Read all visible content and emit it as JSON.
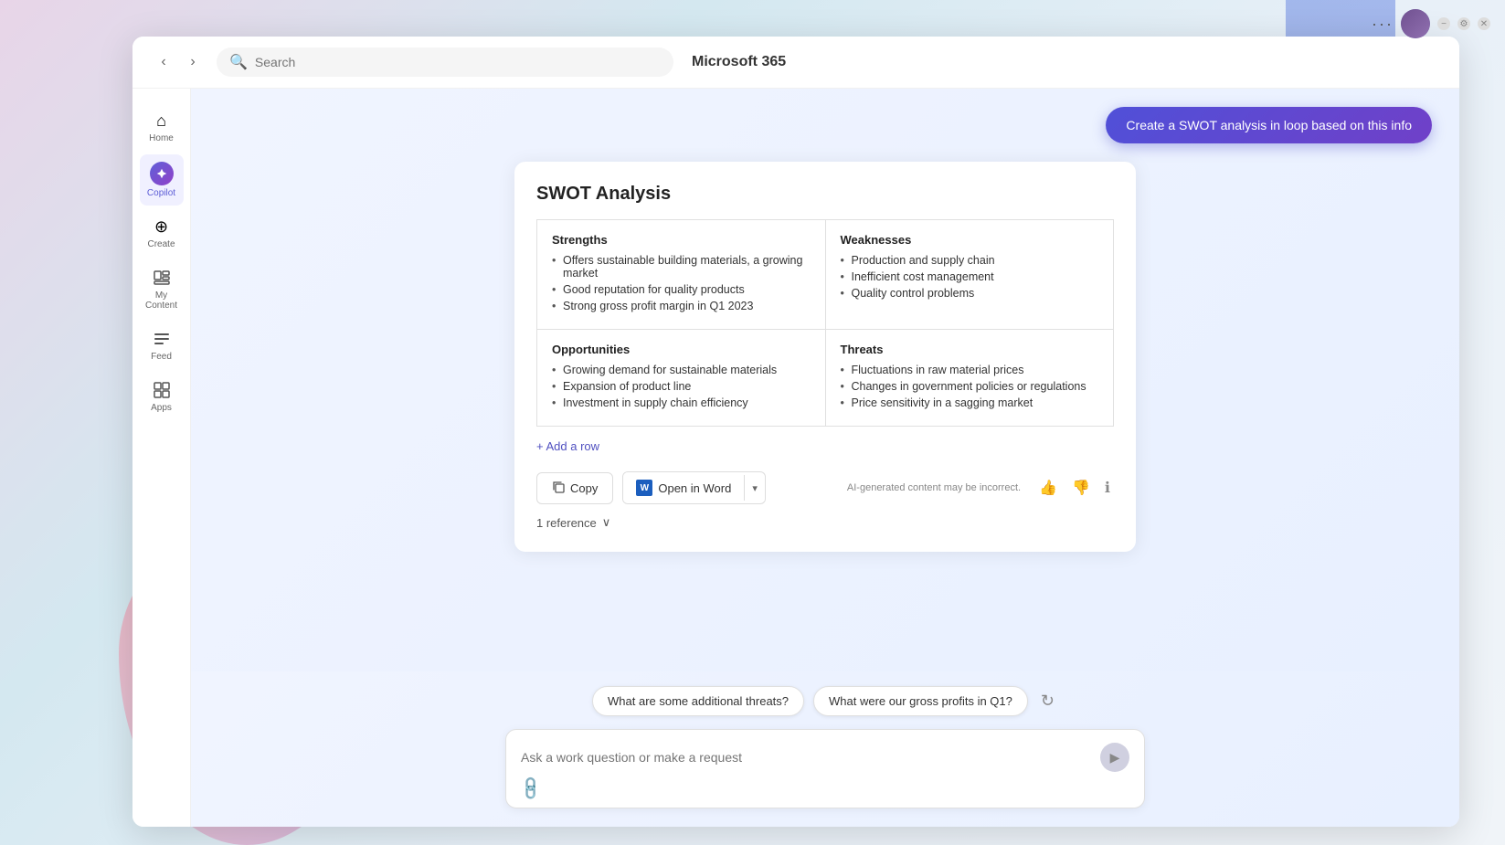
{
  "window": {
    "title": "Microsoft 365",
    "controls": {
      "dots": "···",
      "minimize": "−",
      "settings": "⚙",
      "close": "✕"
    }
  },
  "topbar": {
    "search_placeholder": "Search",
    "app_title": "Microsoft 365"
  },
  "sidebar": {
    "items": [
      {
        "id": "home",
        "label": "Home",
        "icon": "⌂"
      },
      {
        "id": "copilot",
        "label": "Copilot",
        "icon": "✦",
        "active": true
      },
      {
        "id": "create",
        "label": "Create",
        "icon": "⊕"
      },
      {
        "id": "my-content",
        "label": "My Content",
        "icon": "▤"
      },
      {
        "id": "feed",
        "label": "Feed",
        "icon": "≡"
      },
      {
        "id": "apps",
        "label": "Apps",
        "icon": "⊞"
      }
    ]
  },
  "create_swot_button": "Create a SWOT analysis in loop based on this info",
  "swot": {
    "title": "SWOT Analysis",
    "strengths": {
      "heading": "Strengths",
      "items": [
        "Offers sustainable building materials, a growing market",
        "Good reputation for quality products",
        "Strong gross profit margin in Q1 2023"
      ]
    },
    "weaknesses": {
      "heading": "Weaknesses",
      "items": [
        "Production and supply chain",
        "Inefficient cost management",
        "Quality control problems"
      ]
    },
    "opportunities": {
      "heading": "Opportunities",
      "items": [
        "Growing demand for sustainable materials",
        "Expansion of product line",
        "Investment in supply chain efficiency"
      ]
    },
    "threats": {
      "heading": "Threats",
      "items": [
        "Fluctuations in raw material prices",
        "Changes in government policies or regulations",
        "Price sensitivity in a sagging market"
      ]
    },
    "add_row": "+ Add a row"
  },
  "actions": {
    "copy": "Copy",
    "open_word": "Open in Word",
    "word_icon": "W",
    "ai_notice": "AI-generated content may be incorrect."
  },
  "reference": {
    "label": "1 reference",
    "icon": "∨"
  },
  "suggestions": [
    "What are some additional threats?",
    "What were our gross profits in Q1?"
  ],
  "input": {
    "placeholder": "Ask a work question or make a request"
  }
}
